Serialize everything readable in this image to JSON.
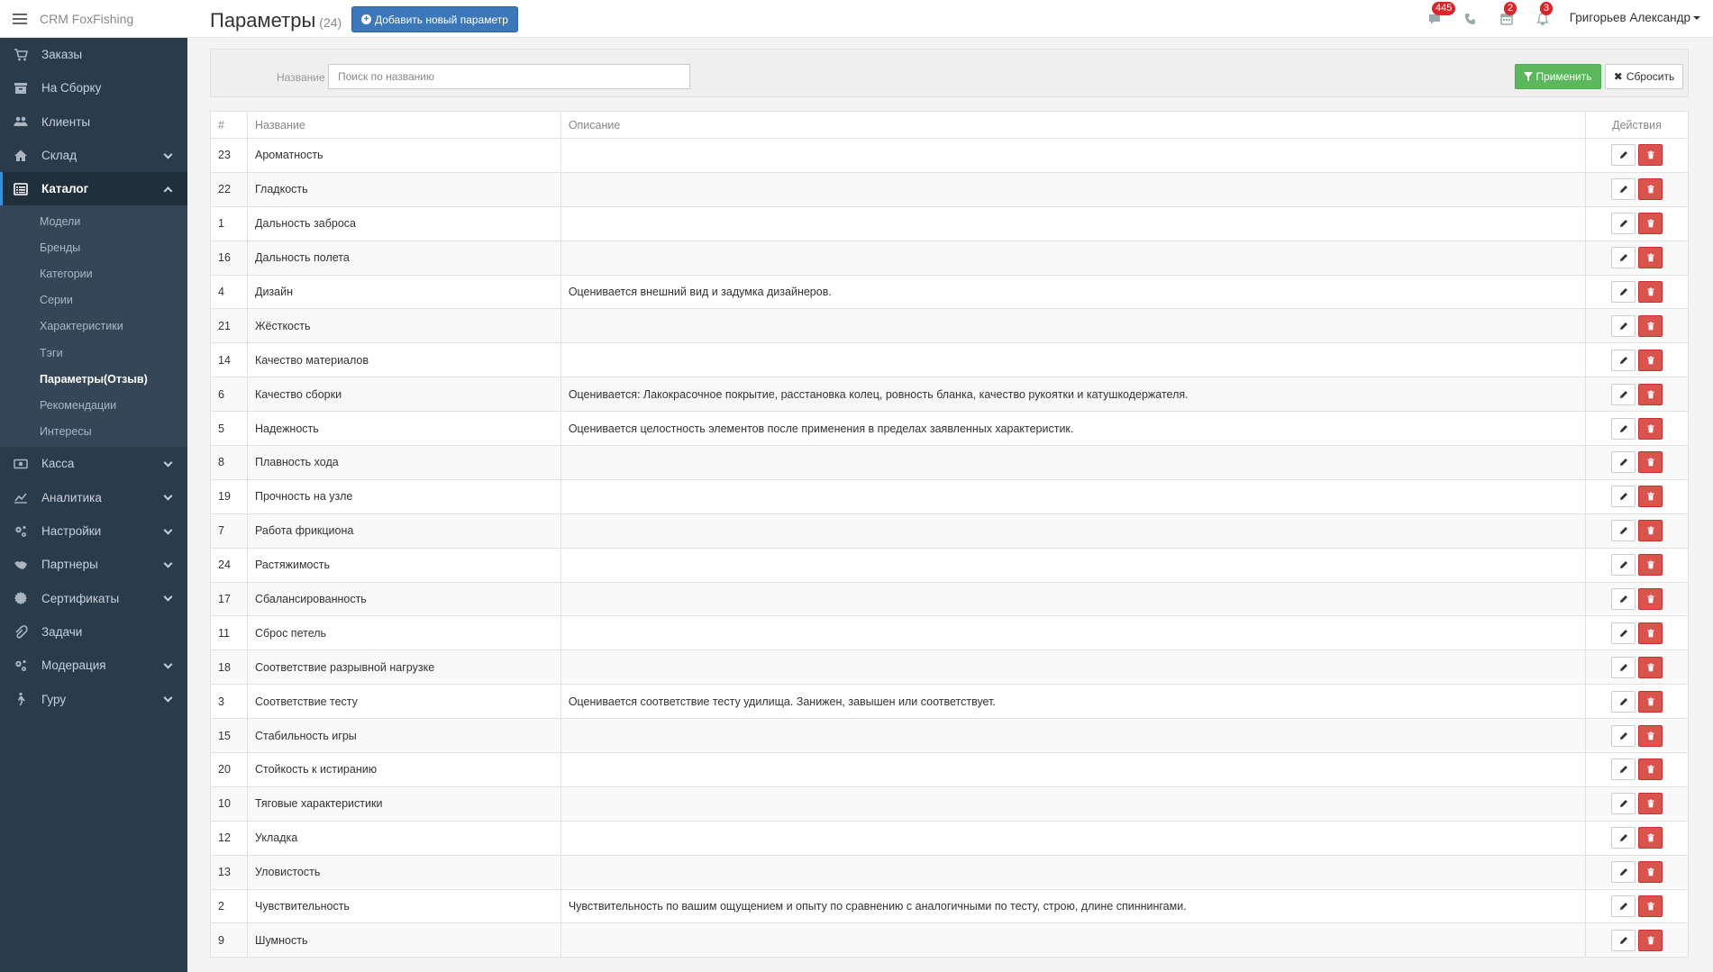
{
  "brand": {
    "name": "CRM FoxFishing"
  },
  "sidebar": {
    "items_top": [
      {
        "label": "Заказы",
        "icon": "cart-icon",
        "chevron": false
      },
      {
        "label": "На Сборку",
        "icon": "box-icon",
        "chevron": false
      },
      {
        "label": "Клиенты",
        "icon": "users-icon",
        "chevron": false
      },
      {
        "label": "Склад",
        "icon": "home-icon",
        "chevron": true
      }
    ],
    "active": {
      "label": "Каталог",
      "icon": "list-icon"
    },
    "submenu": [
      {
        "label": "Модели",
        "active": false
      },
      {
        "label": "Бренды",
        "active": false
      },
      {
        "label": "Категории",
        "active": false
      },
      {
        "label": "Серии",
        "active": false
      },
      {
        "label": "Характеристики",
        "active": false
      },
      {
        "label": "Тэги",
        "active": false
      },
      {
        "label": "Параметры(Отзыв)",
        "active": true
      },
      {
        "label": "Рекомендации",
        "active": false
      },
      {
        "label": "Интересы",
        "active": false
      }
    ],
    "items_bottom": [
      {
        "label": "Касса",
        "icon": "money-icon",
        "chevron": true
      },
      {
        "label": "Аналитика",
        "icon": "chart-icon",
        "chevron": true
      },
      {
        "label": "Настройки",
        "icon": "gears-icon",
        "chevron": true
      },
      {
        "label": "Партнеры",
        "icon": "handshake-icon",
        "chevron": true
      },
      {
        "label": "Сертификаты",
        "icon": "certificate-icon",
        "chevron": true
      },
      {
        "label": "Задачи",
        "icon": "paperclip-icon",
        "chevron": false
      },
      {
        "label": "Модерация",
        "icon": "gears-icon",
        "chevron": true
      },
      {
        "label": "Гуру",
        "icon": "walker-icon",
        "chevron": true
      }
    ]
  },
  "header": {
    "title": "Параметры",
    "count": "(24)",
    "add_button": "Добавить новый параметр",
    "messages_badge": "445",
    "tasks_badge": "2",
    "notifications_badge": "3",
    "user_name": "Григорьев Александр"
  },
  "filter": {
    "label": "Название",
    "placeholder": "Поиск по названию",
    "apply": "Применить",
    "reset": "Сбросить"
  },
  "table": {
    "headers": {
      "id": "#",
      "name": "Название",
      "desc": "Описание",
      "actions": "Действия"
    },
    "rows": [
      {
        "id": "23",
        "name": "Ароматность",
        "desc": ""
      },
      {
        "id": "22",
        "name": "Гладкость",
        "desc": ""
      },
      {
        "id": "1",
        "name": "Дальность заброса",
        "desc": ""
      },
      {
        "id": "16",
        "name": "Дальность полета",
        "desc": ""
      },
      {
        "id": "4",
        "name": "Дизайн",
        "desc": "Оценивается внешний вид и задумка дизайнеров."
      },
      {
        "id": "21",
        "name": "Жёсткость",
        "desc": ""
      },
      {
        "id": "14",
        "name": "Качество материалов",
        "desc": ""
      },
      {
        "id": "6",
        "name": "Качество сборки",
        "desc": "Оценивается: Лакокрасочное покрытие, расстановка колец, ровность бланка, качество рукоятки и катушкодержателя."
      },
      {
        "id": "5",
        "name": "Надежность",
        "desc": "Оценивается целостность элементов после применения в пределах заявленных характеристик."
      },
      {
        "id": "8",
        "name": "Плавность хода",
        "desc": ""
      },
      {
        "id": "19",
        "name": "Прочность на узле",
        "desc": ""
      },
      {
        "id": "7",
        "name": "Работа фрикциона",
        "desc": ""
      },
      {
        "id": "24",
        "name": "Растяжимость",
        "desc": ""
      },
      {
        "id": "17",
        "name": "Сбалансированность",
        "desc": ""
      },
      {
        "id": "11",
        "name": "Сброс петель",
        "desc": ""
      },
      {
        "id": "18",
        "name": "Соответствие разрывной нагрузке",
        "desc": ""
      },
      {
        "id": "3",
        "name": "Соответствие тесту",
        "desc": "Оценивается соответствие тесту удилища. Занижен, завышен или соответствует."
      },
      {
        "id": "15",
        "name": "Стабильность игры",
        "desc": ""
      },
      {
        "id": "20",
        "name": "Стойкость к истиранию",
        "desc": ""
      },
      {
        "id": "10",
        "name": "Тяговые характеристики",
        "desc": ""
      },
      {
        "id": "12",
        "name": "Укладка",
        "desc": ""
      },
      {
        "id": "13",
        "name": "Уловистость",
        "desc": ""
      },
      {
        "id": "2",
        "name": "Чувствительность",
        "desc": "Чувствительность по вашим ощущением и опыту по сравнению с аналогичными по тесту, строю, длине спиннингами."
      },
      {
        "id": "9",
        "name": "Шумность",
        "desc": ""
      }
    ]
  }
}
